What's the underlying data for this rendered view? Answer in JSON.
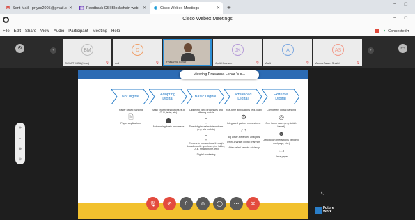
{
  "browser": {
    "tabs": [
      {
        "icon": "gmail-icon",
        "label": "Sent Mail - priyas2005@gmail.c",
        "active": false
      },
      {
        "icon": "feedback-icon",
        "label": "Feedback CSI Blockchain webi",
        "active": false
      },
      {
        "icon": "webex-icon",
        "label": "Cisco Webex Meetings",
        "active": true
      }
    ],
    "new_tab": "+",
    "window_controls": "− □"
  },
  "app": {
    "title": "Cisco Webex Meetings",
    "window_controls": "− □",
    "menu": [
      "File",
      "Edit",
      "Share",
      "View",
      "Audio",
      "Participant",
      "Meeting",
      "Help"
    ],
    "status": "Connected ▾"
  },
  "participants": [
    {
      "initials": "BM",
      "name": "BVIMIT MCA (Host)",
      "video": false,
      "color": "#bdbdbd"
    },
    {
      "initials": "D",
      "name": "deli",
      "video": false,
      "color": "#f0a06a"
    },
    {
      "initials": "",
      "name": "Prasanna Lohar",
      "video": true,
      "color": ""
    },
    {
      "initials": "JK",
      "name": "Jyoti Kharade",
      "video": false,
      "color": "#b59ad8"
    },
    {
      "initials": "A",
      "name": "Aarti",
      "video": false,
      "color": "#7aa6e0"
    },
    {
      "initials": "AS",
      "name": "Amina Azam Shaikh",
      "video": false,
      "color": "#f29a8a"
    }
  ],
  "viewing_banner": "Viewing Prasanna Lohar 's s...",
  "slide": {
    "banner_letter": "s",
    "stages": [
      {
        "label": "Not digital",
        "items": [
          "Paper based banking",
          "Paper applications"
        ],
        "icons": [
          "document-icon"
        ]
      },
      {
        "label": "Adopting Digital",
        "items": [
          "Basic channels solutions (e.g. OLB, teller, etc)",
          "Automating basic processes"
        ],
        "icons": [
          "network-icon"
        ]
      },
      {
        "label": "Basic Digital",
        "items": [
          "Digitising bank processes and offering portals",
          "Direct digital sales interactions (e.g. via mobile)",
          "Electronic transactions through broad mobile spectrum (i.e. tablet, OLB, smartphone, etc)",
          "Digital marketing"
        ],
        "icons": [
          "phone-hand-icon",
          "mobile-icon"
        ]
      },
      {
        "label": "Advanced Digital",
        "items": [
          "Real-time applications (e.g. loan)",
          "Integrated partner ecosystems",
          "Big Data/ advanced analytics",
          "Omni-channel digital channels",
          "Video teller/ remote advisory"
        ],
        "icons": [
          "gear-cluster-icon",
          "wifi-icon",
          "headset-icon"
        ]
      },
      {
        "label": "Extreme Digital",
        "items": [
          "Completely digital banking",
          "One touch sales (e.g. tablet-based)",
          "Zero touch interactions (lending, mortgage, etc.)",
          "...less paper"
        ],
        "icons": [
          "broadcast-icon",
          "person-icon",
          "tablet-icon"
        ]
      }
    ],
    "brand": {
      "line1": "Future",
      "line2": "Work"
    }
  },
  "controls": [
    {
      "name": "mute-button",
      "icon": "mic-icon",
      "glyph": "✕",
      "color": "red"
    },
    {
      "name": "video-button",
      "icon": "camera-off-icon",
      "glyph": "⊘",
      "color": "red"
    },
    {
      "name": "share-button",
      "icon": "share-icon",
      "glyph": "↑",
      "color": "grey"
    },
    {
      "name": "participants-button",
      "icon": "person-icon",
      "glyph": "☺",
      "color": "grey"
    },
    {
      "name": "chat-button",
      "icon": "chat-icon",
      "glyph": "○",
      "color": "grey"
    },
    {
      "name": "more-button",
      "icon": "more-icon",
      "glyph": "…",
      "color": "grey"
    },
    {
      "name": "leave-button",
      "icon": "close-icon",
      "glyph": "✕",
      "color": "red"
    }
  ]
}
